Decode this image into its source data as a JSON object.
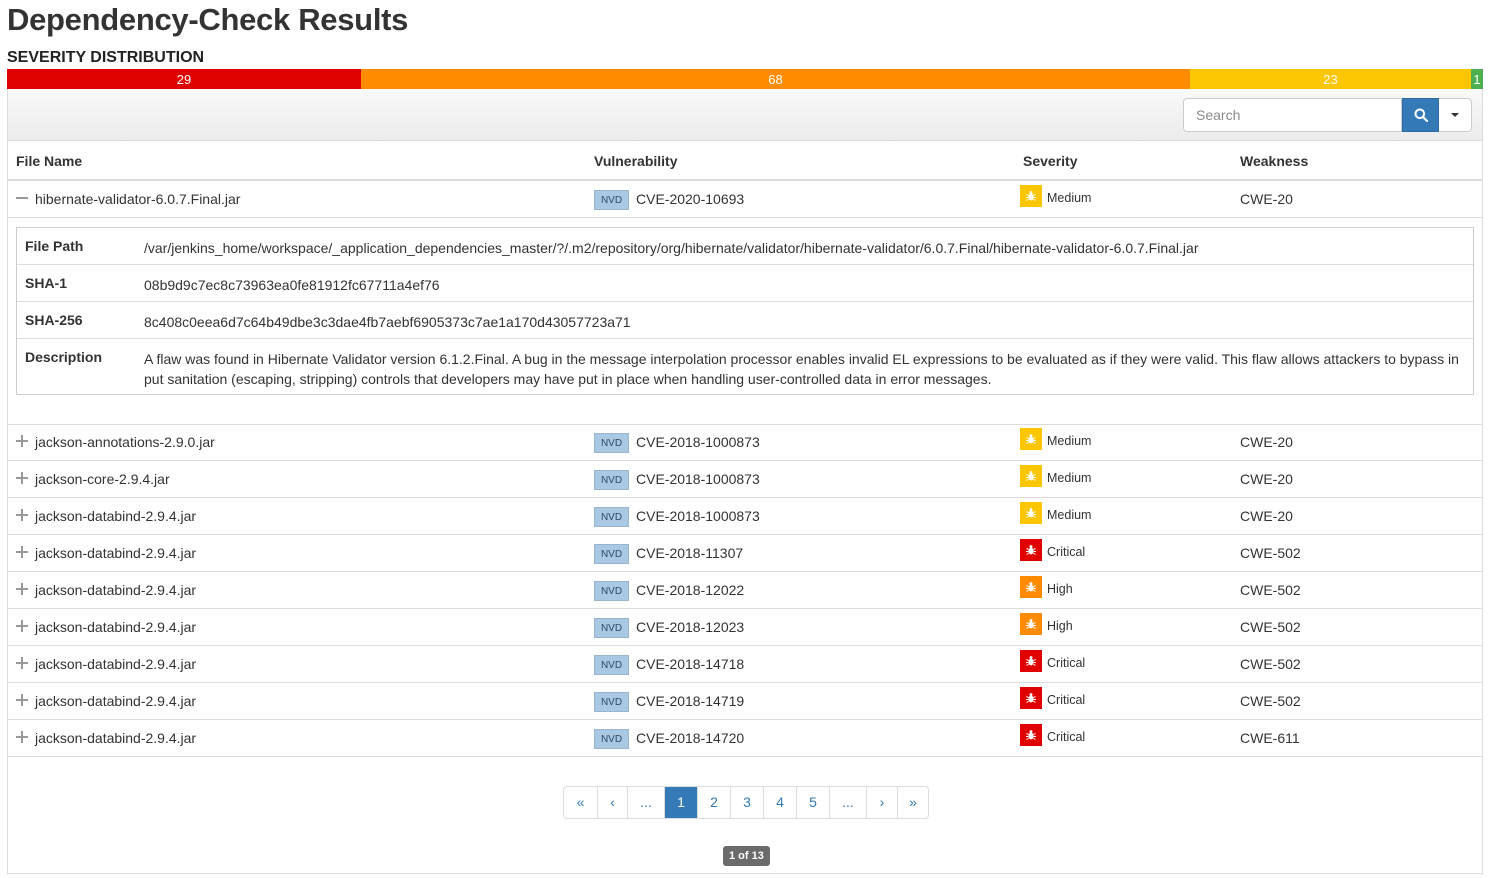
{
  "page": {
    "title": "Dependency-Check Results",
    "severity_heading": "SEVERITY DISTRIBUTION"
  },
  "severity_distribution": {
    "critical": "29",
    "high": "68",
    "medium": "23",
    "low": "1",
    "colors": {
      "critical": "#e10000",
      "high": "#ff8c00",
      "medium": "#fcc600",
      "low": "#4caf50"
    }
  },
  "toolbar": {
    "search_placeholder": "Search",
    "search_icon": "search-icon",
    "dropdown_icon": "chevron-down-icon"
  },
  "table": {
    "headers": {
      "file": "File Name",
      "vuln": "Vulnerability",
      "severity": "Severity",
      "weakness": "Weakness"
    },
    "source_tag": "NVD",
    "rows": [
      {
        "file": "hibernate-validator-6.0.7.Final.jar",
        "cve": "CVE-2020-10693",
        "severity": "Medium",
        "cwe": "CWE-20",
        "expanded": true
      },
      {
        "file": "jackson-annotations-2.9.0.jar",
        "cve": "CVE-2018-1000873",
        "severity": "Medium",
        "cwe": "CWE-20"
      },
      {
        "file": "jackson-core-2.9.4.jar",
        "cve": "CVE-2018-1000873",
        "severity": "Medium",
        "cwe": "CWE-20"
      },
      {
        "file": "jackson-databind-2.9.4.jar",
        "cve": "CVE-2018-1000873",
        "severity": "Medium",
        "cwe": "CWE-20"
      },
      {
        "file": "jackson-databind-2.9.4.jar",
        "cve": "CVE-2018-11307",
        "severity": "Critical",
        "cwe": "CWE-502"
      },
      {
        "file": "jackson-databind-2.9.4.jar",
        "cve": "CVE-2018-12022",
        "severity": "High",
        "cwe": "CWE-502"
      },
      {
        "file": "jackson-databind-2.9.4.jar",
        "cve": "CVE-2018-12023",
        "severity": "High",
        "cwe": "CWE-502"
      },
      {
        "file": "jackson-databind-2.9.4.jar",
        "cve": "CVE-2018-14718",
        "severity": "Critical",
        "cwe": "CWE-502"
      },
      {
        "file": "jackson-databind-2.9.4.jar",
        "cve": "CVE-2018-14719",
        "severity": "Critical",
        "cwe": "CWE-502"
      },
      {
        "file": "jackson-databind-2.9.4.jar",
        "cve": "CVE-2018-14720",
        "severity": "Critical",
        "cwe": "CWE-611"
      }
    ]
  },
  "detail": {
    "file_path_label": "File Path",
    "file_path": "/var/jenkins_home/workspace/_application_dependencies_master/?/.m2/repository/org/hibernate/validator/hibernate-validator/6.0.7.Final/hibernate-validator-6.0.7.Final.jar",
    "sha1_label": "SHA-1",
    "sha1": "08b9d9c7ec8c73963ea0fe81912fc67711a4ef76",
    "sha256_label": "SHA-256",
    "sha256": "8c408c0eea6d7c64b49dbe3c3dae4fb7aebf6905373c7ae1a170d43057723a71",
    "description_label": "Description",
    "description_line1": "A flaw was found in Hibernate Validator version 6.1.2.Final. A bug in the message interpolation processor enables invalid EL expressions to be evaluated as if they were valid. This flaw allows attackers to bypass in",
    "description_line2": "put sanitation (escaping, stripping) controls that developers may have put in place when handling user-controlled data in error messages."
  },
  "pagination": {
    "first": "«",
    "prev": "‹",
    "ellipsis_left": "...",
    "pages": [
      "1",
      "2",
      "3",
      "4",
      "5"
    ],
    "ellipsis_right": "...",
    "next": "›",
    "last": "»",
    "current": "1",
    "count_label": "1 of 13"
  }
}
